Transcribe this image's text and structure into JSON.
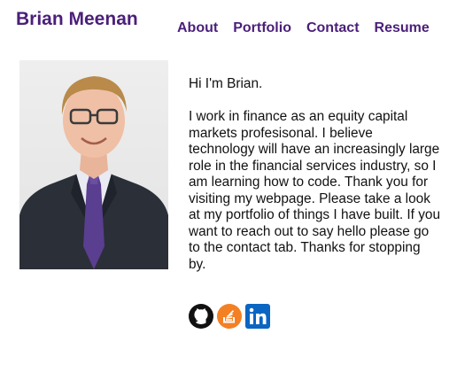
{
  "header": {
    "title": "Brian Meenan",
    "nav": [
      {
        "label": "About"
      },
      {
        "label": "Portfolio"
      },
      {
        "label": "Contact"
      },
      {
        "label": "Resume"
      }
    ]
  },
  "about": {
    "greeting": "Hi I'm Brian.",
    "body": "I work in finance as an equity capital markets profesisonal. I believe technology will have an increasingly large role in the financial services industry, so I am learning how to code. Thank you for visiting my webpage. Please take a look at my portfolio of things I have built. If you want to reach out to say hello please go to the contact tab. Thanks for stopping by."
  },
  "socials": [
    {
      "icon": "github-icon"
    },
    {
      "icon": "stackoverflow-icon"
    },
    {
      "icon": "linkedin-icon"
    }
  ],
  "colors": {
    "brand": "#4b1f7a",
    "stackoverflow": "#f48024",
    "linkedin": "#0a66c2"
  }
}
